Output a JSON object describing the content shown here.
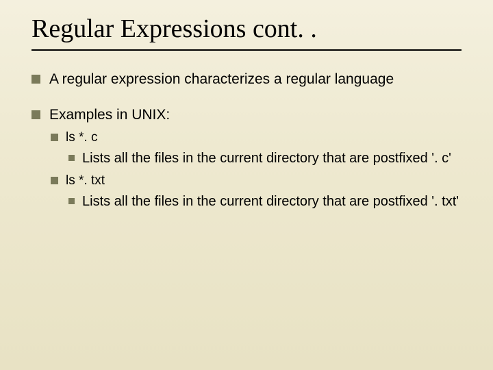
{
  "slide": {
    "title": "Regular Expressions cont. .",
    "bullets": [
      {
        "text": "A regular expression characterizes a regular language"
      },
      {
        "text": "Examples in UNIX:",
        "children": [
          {
            "text": "ls  *. c",
            "children": [
              {
                "text": "Lists all the files in the current directory that are postfixed '. c'"
              }
            ]
          },
          {
            "text": "ls *. txt",
            "children": [
              {
                "text": "Lists all the files in the current directory that are postfixed '. txt'"
              }
            ]
          }
        ]
      }
    ]
  }
}
